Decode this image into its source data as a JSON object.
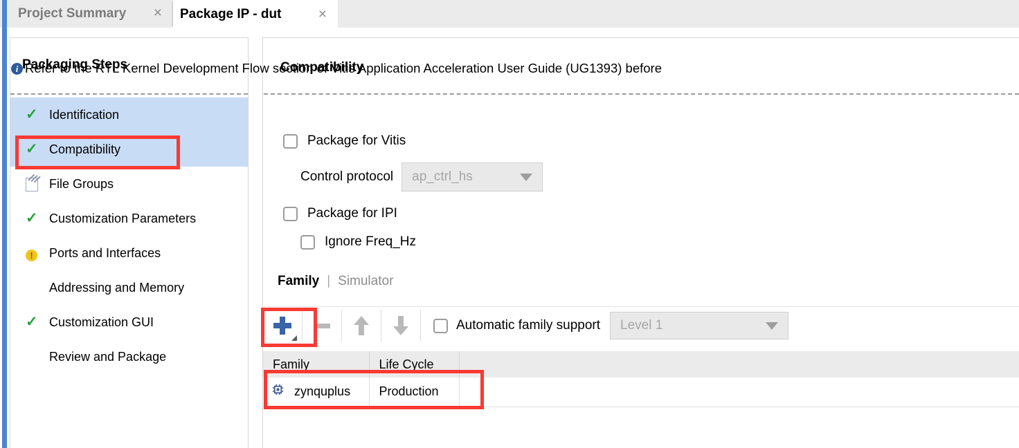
{
  "tabs": [
    {
      "label": "Project Summary",
      "close": "×",
      "active": false
    },
    {
      "label": "Package IP - dut",
      "close": "×",
      "active": true
    }
  ],
  "sidebar": {
    "title": "Packaging Steps",
    "items": [
      {
        "label": "Identification",
        "status": "check",
        "selected": true
      },
      {
        "label": "Compatibility",
        "status": "check",
        "selected": true
      },
      {
        "label": "File Groups",
        "status": "pencil",
        "selected": false
      },
      {
        "label": "Customization Parameters",
        "status": "check",
        "selected": false
      },
      {
        "label": "Ports and Interfaces",
        "status": "warn",
        "selected": false
      },
      {
        "label": "Addressing and Memory",
        "status": "none",
        "selected": false
      },
      {
        "label": "Customization GUI",
        "status": "check",
        "selected": false
      },
      {
        "label": "Review and Package",
        "status": "none",
        "selected": false
      }
    ]
  },
  "main": {
    "title": "Compatibility",
    "info": {
      "icon": "info-icon",
      "text": "Refer to the RTL Kernel Development Flow section of Vitis Application Acceleration User Guide (UG1393) before"
    },
    "package_for_vitis": {
      "label": "Package for Vitis",
      "checked": false
    },
    "control_protocol": {
      "label": "Control protocol",
      "value": "ap_ctrl_hs",
      "disabled": true
    },
    "package_for_ipi": {
      "label": "Package for IPI",
      "checked": false
    },
    "ignore_freq_hz": {
      "label": "Ignore Freq_Hz",
      "checked": false
    },
    "subtabs": {
      "active": "Family",
      "separator": "|",
      "inactive": "Simulator"
    },
    "toolbar": {
      "add_label": "+",
      "remove_label": "−",
      "move_up_label": "Move Up",
      "move_down_label": "Move Down",
      "auto_family_support": {
        "label": "Automatic family support",
        "checked": false
      },
      "level": {
        "value": "Level 1",
        "disabled": true
      }
    },
    "table": {
      "columns": [
        "Family",
        "Life Cycle",
        ""
      ],
      "rows": [
        {
          "family": "zynquplus",
          "life_cycle": "Production",
          "icon": "chip-icon",
          "extra": ""
        }
      ]
    }
  },
  "colors": {
    "accent_blue": "#4a86d0",
    "selection_blue": "#c9dcf5",
    "annotation_red": "#f93a33",
    "check_green": "#22a33a",
    "warn_yellow": "#f0c41b",
    "plus_blue": "#3a63a8",
    "info_blue": "#2e5b9a"
  }
}
